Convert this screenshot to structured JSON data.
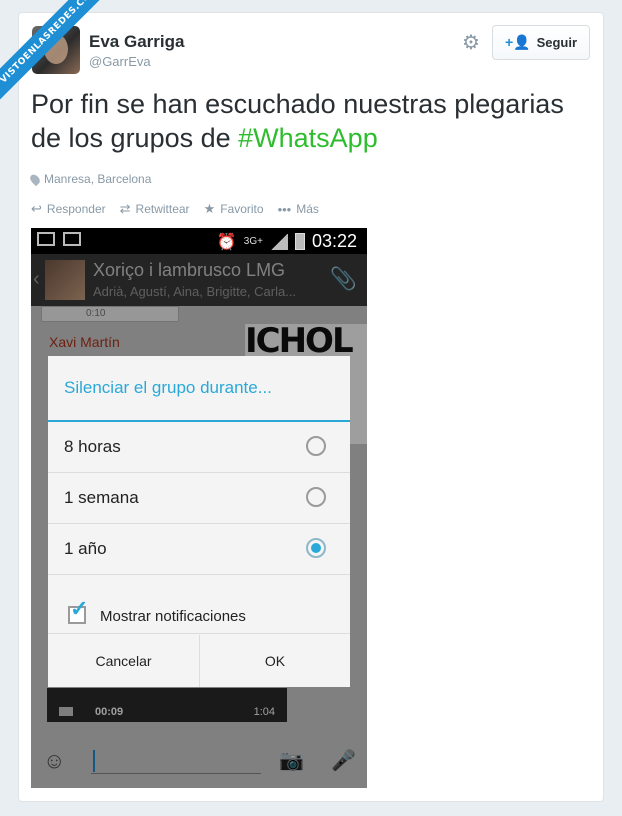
{
  "watermark": "VISTOENLASREDES.COM",
  "tweet": {
    "display_name": "Eva Garriga",
    "handle": "@GarrEva",
    "follow_label": "Seguir",
    "text_prefix": "Por fin se han escuchado nuestras plegarias de los grupos de ",
    "hashtag": "#WhatsApp",
    "location": "Manresa, Barcelona",
    "actions": {
      "reply": "Responder",
      "retweet": "Retwittear",
      "favorite": "Favorito",
      "more": "Más"
    }
  },
  "colors": {
    "hashtag": "#2ebd2e",
    "accent": "#1e8fd4",
    "dialog_accent": "#2aa9d8"
  },
  "phone": {
    "statusbar": {
      "network": "3G+",
      "time": "03:22"
    },
    "chat": {
      "title": "Xoriço i lambrusco LMG",
      "members": "Adrià, Agustí, Aina, Brigitte, Carla...",
      "bubble_time": "0:10",
      "sender": "Xavi Martín",
      "poster_text": "ICHOL",
      "video_duration": "00:09",
      "video_length": "1:04"
    },
    "dialog": {
      "title": "Silenciar el grupo durante...",
      "options": [
        {
          "label": "8 horas",
          "selected": false
        },
        {
          "label": "1 semana",
          "selected": false
        },
        {
          "label": "1 año",
          "selected": true
        }
      ],
      "checkbox_label": "Mostrar notificaciones",
      "checkbox_checked": true,
      "cancel_label": "Cancelar",
      "ok_label": "OK"
    }
  },
  "icons": {
    "gear": "gear-icon",
    "follow": "add-user-icon",
    "location": "pin-icon",
    "reply": "reply-icon",
    "retweet": "retweet-icon",
    "favorite": "star-icon",
    "more": "ellipsis-icon"
  }
}
